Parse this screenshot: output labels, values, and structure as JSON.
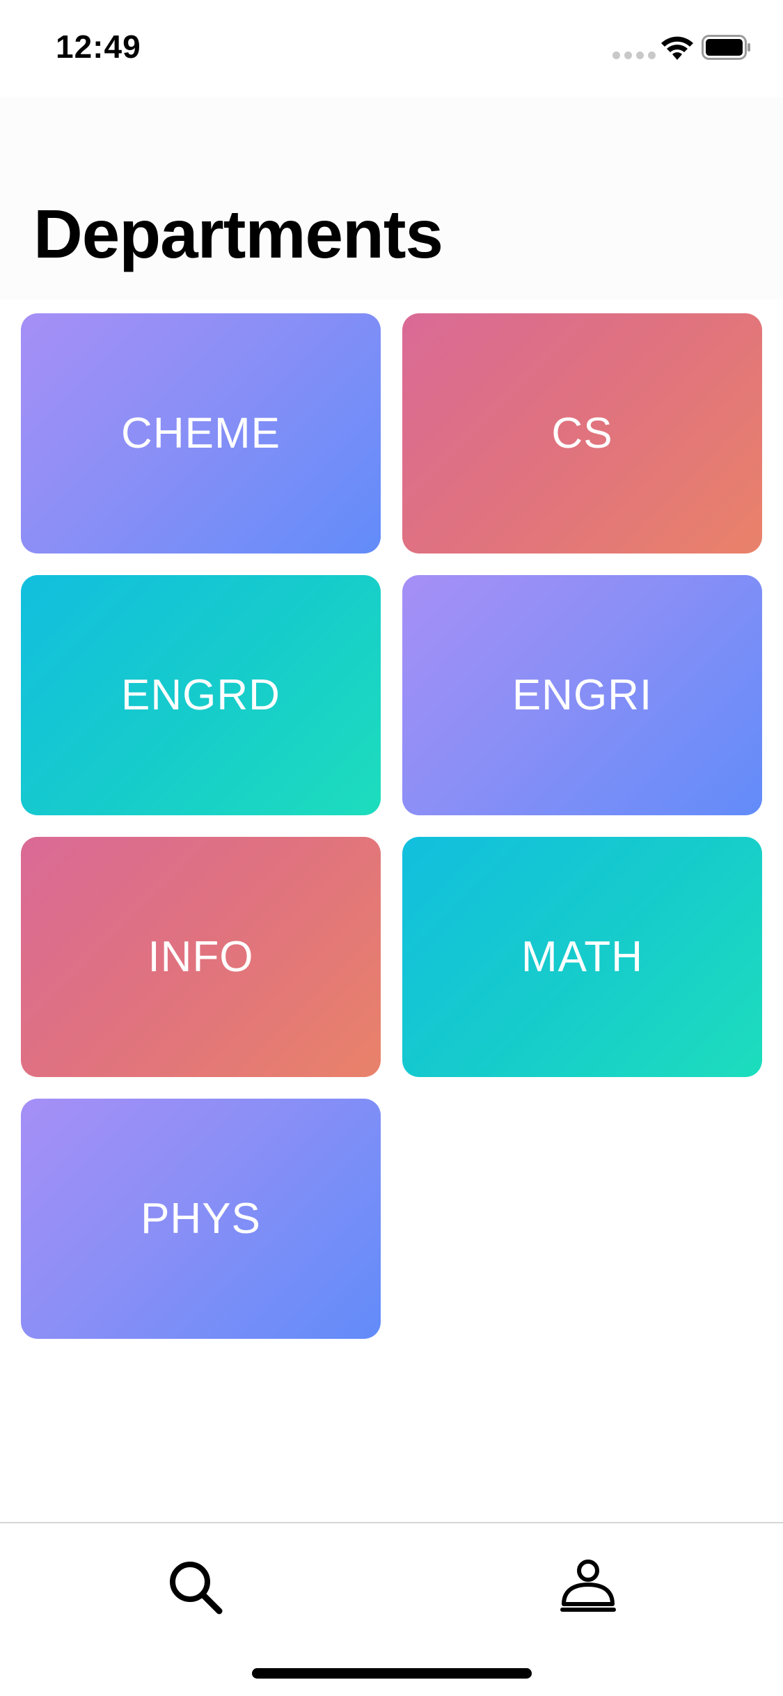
{
  "status_bar": {
    "time": "12:49",
    "icons": [
      "signal-dots-icon",
      "wifi-icon",
      "battery-icon"
    ]
  },
  "header": {
    "title": "Departments"
  },
  "departments": [
    {
      "label": "CHEME",
      "gradient": [
        "#a68ff6",
        "#628cf9"
      ]
    },
    {
      "label": "CS",
      "gradient": [
        "#da6a96",
        "#e9826a"
      ]
    },
    {
      "label": "ENGRD",
      "gradient": [
        "#12bfde",
        "#1dddbd"
      ]
    },
    {
      "label": "ENGRI",
      "gradient": [
        "#a68ff6",
        "#628cf9"
      ]
    },
    {
      "label": "INFO",
      "gradient": [
        "#da6a96",
        "#e9826a"
      ]
    },
    {
      "label": "MATH",
      "gradient": [
        "#12bfde",
        "#1dddbd"
      ]
    },
    {
      "label": "PHYS",
      "gradient": [
        "#a68ff6",
        "#628cf9"
      ]
    }
  ],
  "tab_bar": {
    "tabs": [
      {
        "icon": "search-icon",
        "selected": true
      },
      {
        "icon": "person-icon",
        "selected": false
      }
    ]
  }
}
